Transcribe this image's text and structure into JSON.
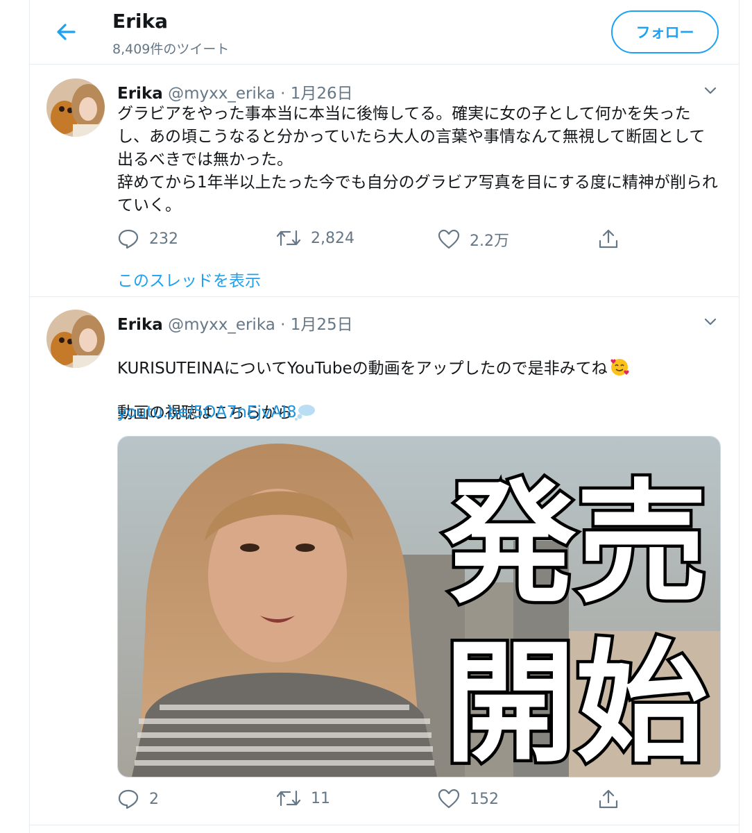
{
  "header": {
    "title": "Erika",
    "subtitle": "8,409件のツイート",
    "follow_label": "フォロー"
  },
  "tweets": [
    {
      "name": "Erika",
      "handle": "@myxx_erika",
      "sep": "·",
      "date": "1月26日",
      "text": "グラビアをやった事本当に本当に後悔してる。確実に女の子として何かを失ったし、あの頃こうなると分かっていたら大人の言葉や事情なんて無視して断固として出るべきでは無かった。\n辞めてから1年半以上たった今でも自分のグラビア写真を目にする度に精神が削られていく。",
      "replies": "232",
      "retweets": "2,824",
      "likes": "2.2万",
      "thread_link": "このスレッドを表示"
    },
    {
      "name": "Erika",
      "handle": "@myxx_erika",
      "sep": "·",
      "date": "1月25日",
      "text": "KURISUTEINAについてYouTubeの動画をアップしたので是非みてね",
      "text2": "動画の視聴はこちらから",
      "link": "youtu.be/5OA7nEjvAI8",
      "media_text_top": "発売",
      "media_text_bottom": "開始",
      "replies": "2",
      "retweets": "11",
      "likes": "152"
    }
  ],
  "icons": [
    "back-arrow-icon",
    "chevron-down-icon",
    "reply-icon",
    "retweet-icon",
    "like-icon",
    "share-icon",
    "smiling-hearts-emoji",
    "thought-bubble-emoji"
  ],
  "colors": {
    "accent": "#1da1f2",
    "link": "#1b95e0",
    "muted": "#657786",
    "border": "#e6ecf0"
  }
}
